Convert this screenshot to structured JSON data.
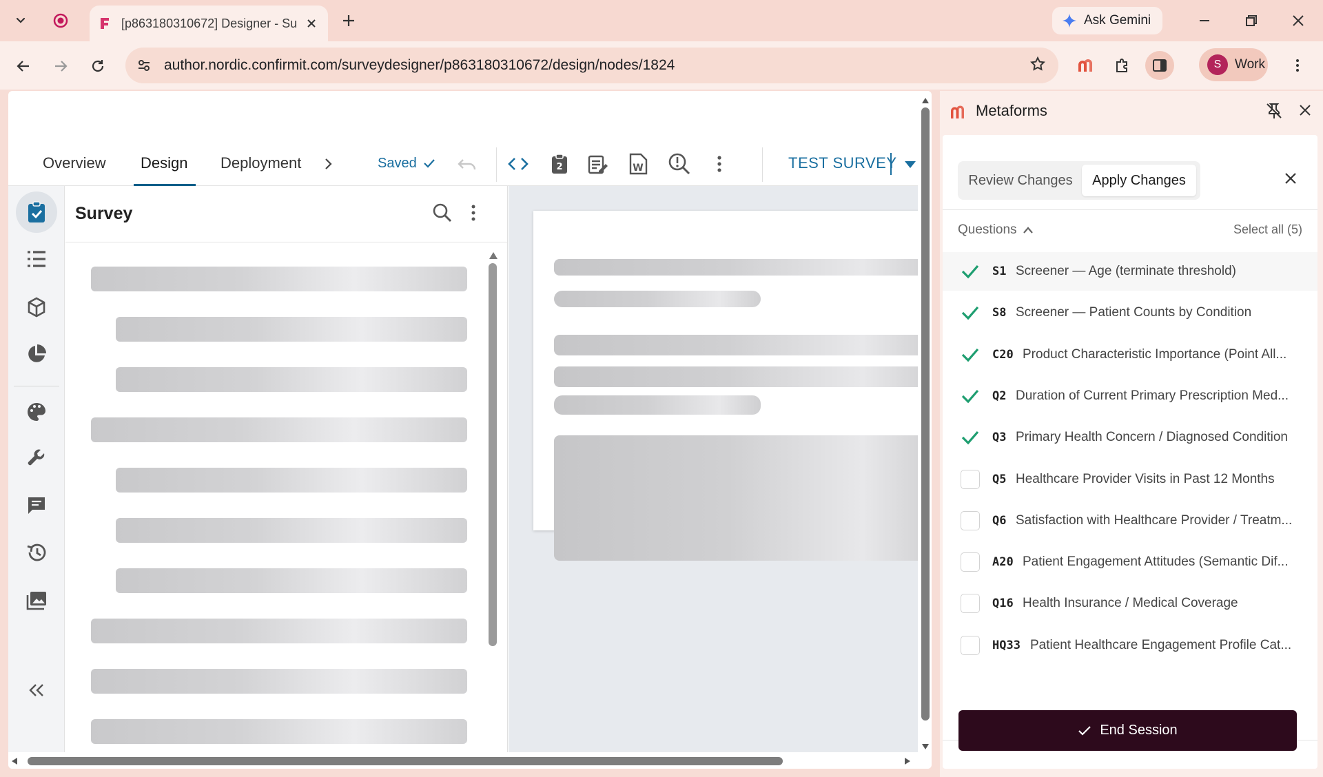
{
  "browser": {
    "tab_title": "[p863180310672] Designer - Su",
    "gemini_label": "Ask Gemini",
    "url": "author.nordic.confirmit.com/surveydesigner/p863180310672/design/nodes/1824",
    "profile_initial": "S",
    "profile_label": "Work"
  },
  "app": {
    "nav_tabs": [
      "Overview",
      "Design",
      "Deployment"
    ],
    "active_tab": "Design",
    "saved_label": "Saved",
    "test_survey_label": "TEST SURVEY",
    "panel_title": "Survey"
  },
  "metaforms": {
    "title": "Metaforms",
    "tabs": [
      "Review Changes",
      "Apply Changes"
    ],
    "active_tab": "Apply Changes",
    "questions_label": "Questions",
    "select_all_label": "Select all (5)",
    "questions": [
      {
        "code": "S1",
        "text": "Screener — Age (terminate threshold)",
        "checked": true
      },
      {
        "code": "S8",
        "text": "Screener — Patient Counts by Condition",
        "checked": true
      },
      {
        "code": "C20",
        "text": "Product Characteristic Importance (Point All...",
        "checked": true
      },
      {
        "code": "Q2",
        "text": "Duration of Current Primary Prescription Med...",
        "checked": true
      },
      {
        "code": "Q3",
        "text": "Primary Health Concern / Diagnosed Condition",
        "checked": true
      },
      {
        "code": "Q5",
        "text": "Healthcare Provider Visits in Past 12 Months",
        "checked": false
      },
      {
        "code": "Q6",
        "text": "Satisfaction with Healthcare Provider / Treatm...",
        "checked": false
      },
      {
        "code": "A20",
        "text": "Patient Engagement Attitudes (Semantic Dif...",
        "checked": false
      },
      {
        "code": "Q16",
        "text": "Health Insurance / Medical Coverage",
        "checked": false
      },
      {
        "code": "HQ33",
        "text": "Patient Healthcare Engagement Profile Cat...",
        "checked": false
      }
    ],
    "end_session_label": "End Session"
  },
  "colors": {
    "accent": "#1a6fa0",
    "check_green": "#1e9e70",
    "end_button": "#2d0a1c",
    "metaforms_logo": "#e2533f"
  }
}
